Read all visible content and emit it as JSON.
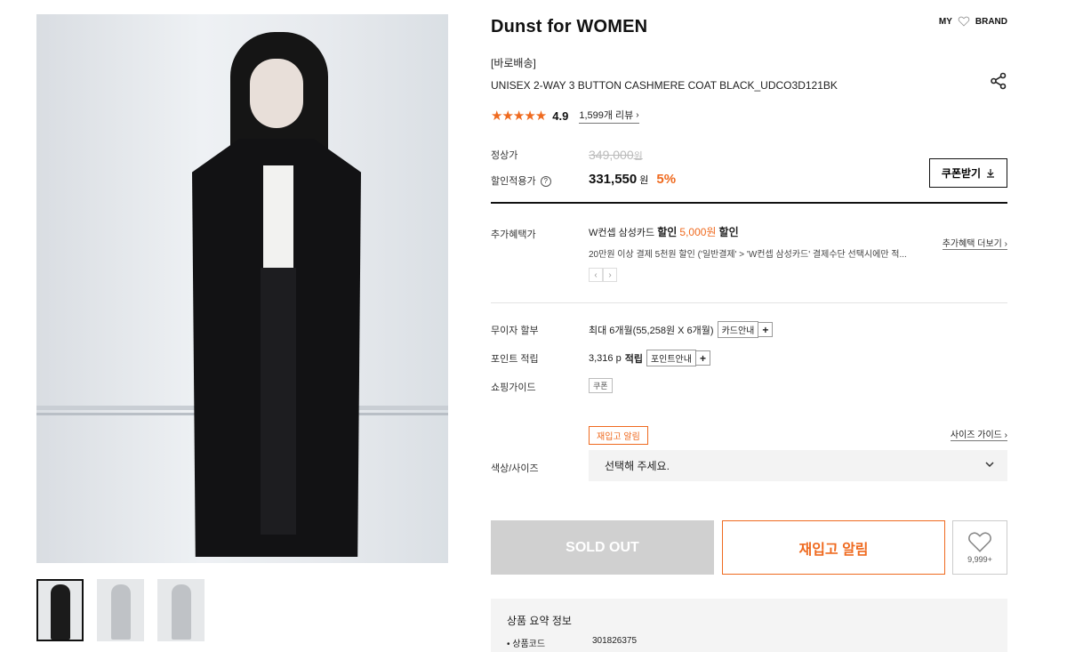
{
  "product": {
    "brand_title": "Dunst for WOMEN",
    "delivery_tag": "[바로배송]",
    "name": "UNISEX 2-WAY 3 BUTTON CASHMERE COAT BLACK_UDCO3D121BK",
    "rating": {
      "stars": "★★★★★",
      "score": "4.9",
      "reviews_label": "1,599개 리뷰"
    }
  },
  "header": {
    "my_label": "MY",
    "brand_label": "BRAND"
  },
  "price": {
    "regular_label": "정상가",
    "regular_value": "349,000",
    "regular_unit": "원",
    "sale_label": "할인적용가",
    "help_icon": "?",
    "sale_value": "331,550",
    "sale_unit": "원",
    "discount_rate": "5%",
    "coupon_button": "쿠폰받기"
  },
  "benefit": {
    "label": "추가혜택가",
    "prefix": "W컨셉 삼성카드",
    "discount_word": "할인",
    "amount": "5,000원",
    "suffix": "할인",
    "description": "20만원 이상 결제 5천원 할인 ('일반결제' > 'W컨셉 삼성카드' 결제수단 선택시에만 적...",
    "more_link": "추가혜택 더보기",
    "pager_prev": "‹",
    "pager_next": "›"
  },
  "installment": {
    "label": "무이자 할부",
    "value": "최대 6개월(55,258원 X 6개월)",
    "button": "카드안내",
    "plus": "+"
  },
  "points": {
    "label": "포인트 적립",
    "value": "3,316 p",
    "suffix": "적립",
    "button": "포인트안내",
    "plus": "+"
  },
  "shopping_guide": {
    "label": "쇼핑가이드",
    "chip": "쿠폰"
  },
  "option": {
    "restock_chip": "재입고 알림",
    "size_guide": "사이즈 가이드",
    "label": "색상/사이즈",
    "select_placeholder": "선택해 주세요."
  },
  "actions": {
    "soldout": "SOLD OUT",
    "restock": "재입고 알림",
    "like_count": "9,999+"
  },
  "summary": {
    "title": "상품 요약 정보",
    "items": [
      {
        "key": "상품코드",
        "value": "301826375"
      }
    ]
  },
  "colors": {
    "accent": "#ef6a1f",
    "soldout_bg": "#d0d0d0",
    "summary_bg": "#f4f4f4"
  }
}
